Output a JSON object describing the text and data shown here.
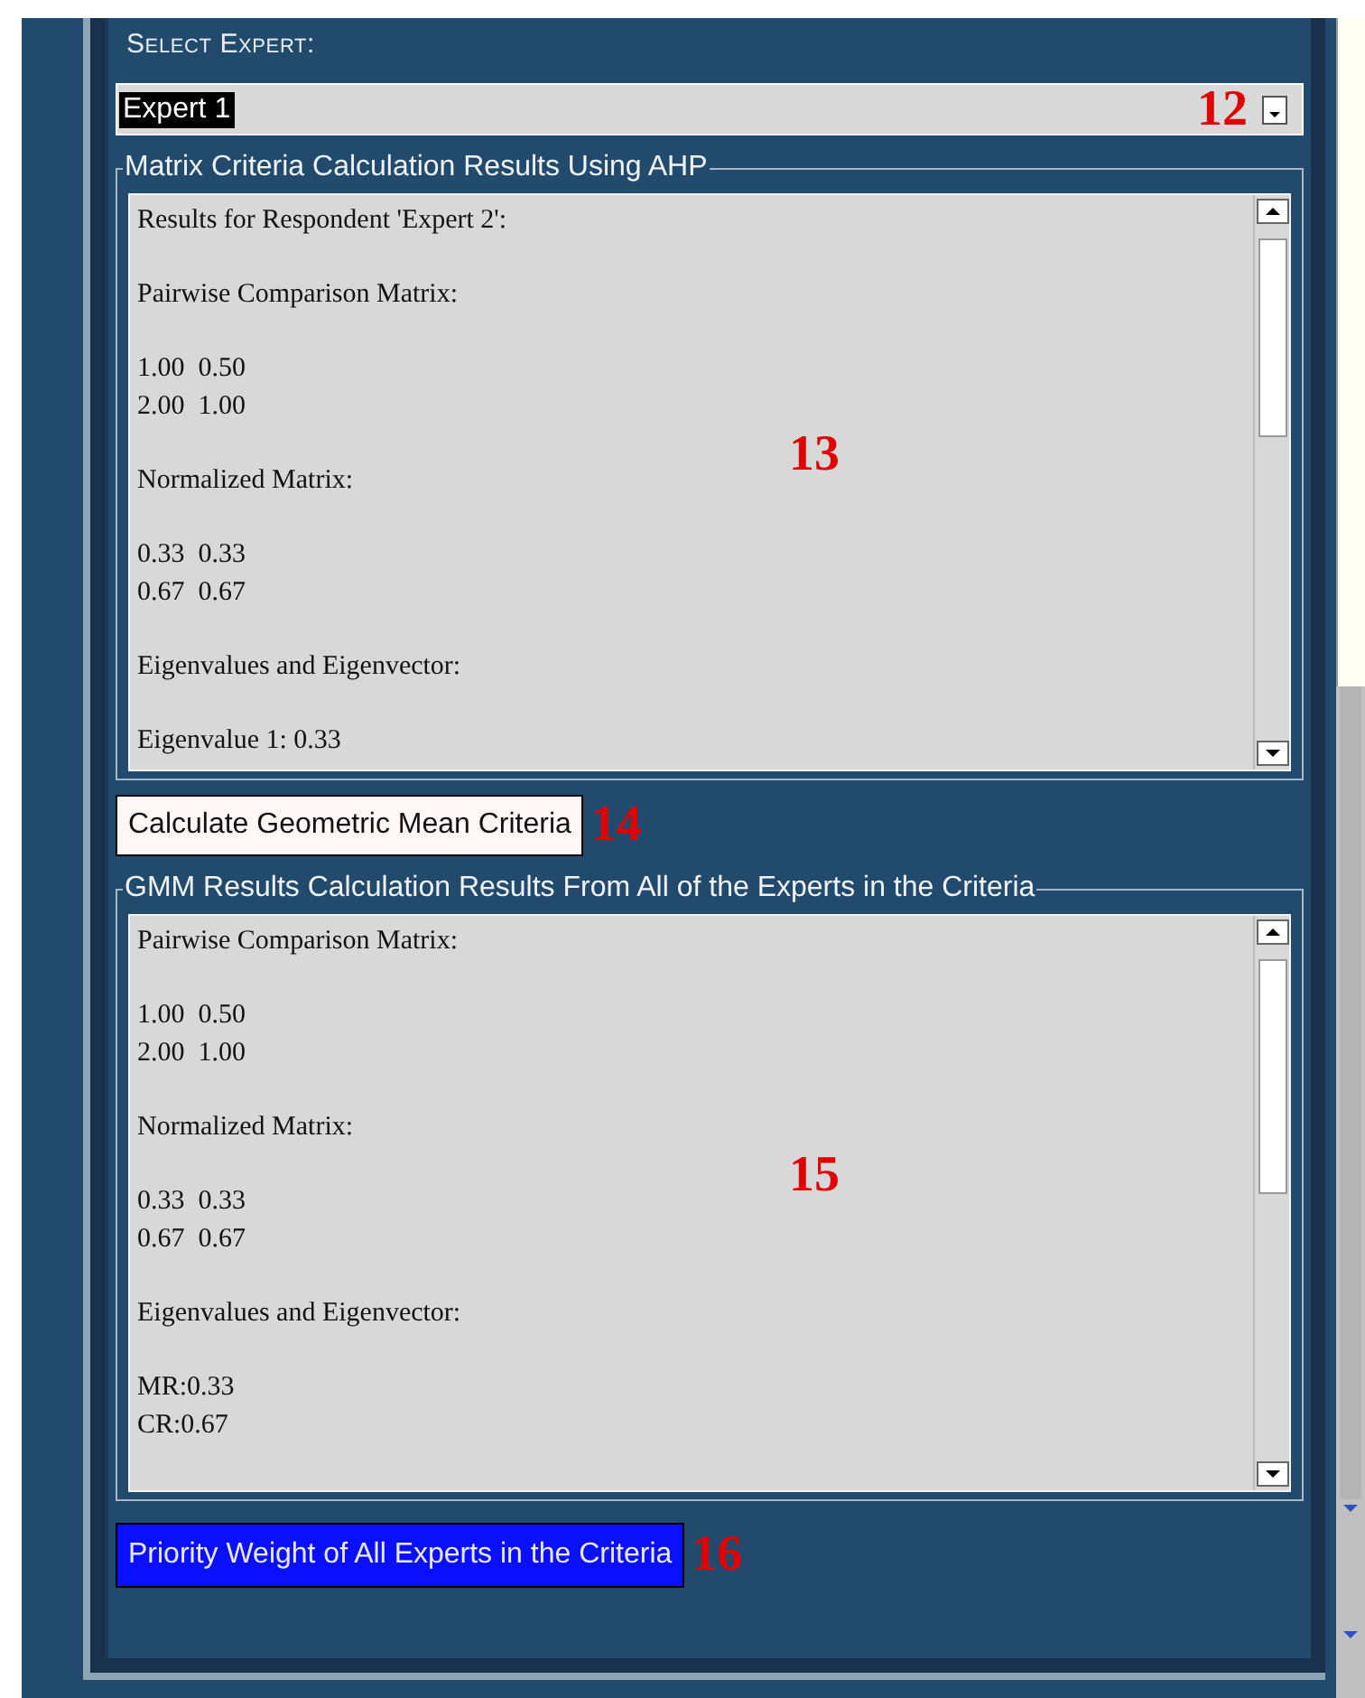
{
  "expert_select": {
    "label": "Select Expert:",
    "value": "Expert 1",
    "marker": "12"
  },
  "ahp_results": {
    "title": "Matrix Criteria Calculation Results Using AHP",
    "marker": "13",
    "blocks": [
      [
        "Results for Respondent 'Expert 2':"
      ],
      [
        "Pairwise Comparison Matrix:"
      ],
      [
        "1.00  0.50",
        "2.00  1.00"
      ],
      [
        "Normalized Matrix:"
      ],
      [
        "0.33  0.33",
        "0.67  0.67"
      ],
      [
        "Eigenvalues and Eigenvector:"
      ],
      [
        "Eigenvalue 1: 0.33"
      ]
    ]
  },
  "geometric_button": {
    "label": "Calculate Geometric Mean Criteria",
    "marker": "14"
  },
  "gmm_results": {
    "title": "GMM Results Calculation Results From All of the Experts in the Criteria",
    "marker": "15",
    "blocks": [
      [
        "Pairwise Comparison Matrix:"
      ],
      [
        "1.00  0.50",
        "2.00  1.00"
      ],
      [
        "Normalized Matrix:"
      ],
      [
        "0.33  0.33",
        "0.67  0.67"
      ],
      [
        "Eigenvalues and Eigenvector:"
      ],
      [
        "MR:0.33",
        "CR:0.67"
      ]
    ]
  },
  "priority_button": {
    "label": "Priority Weight of All Experts in the Criteria",
    "marker": "16"
  }
}
